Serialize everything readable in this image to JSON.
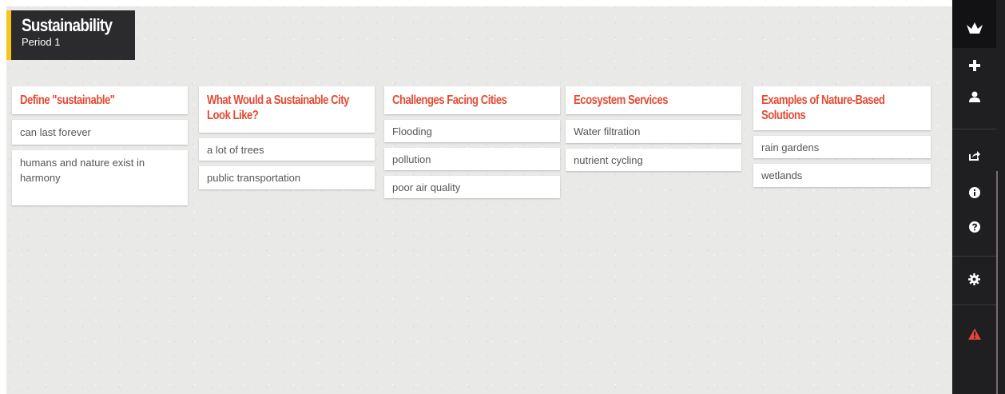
{
  "board": {
    "title": "Sustainability",
    "subtitle": "Period 1"
  },
  "columns": [
    {
      "title": "Define \"sustainable\"",
      "title_lines": [
        "Define \"sustainable\""
      ],
      "items": [
        "can last forever",
        "humans and nature exist in harmony"
      ]
    },
    {
      "title": "What Would a Sustainable City Look Like?",
      "title_lines": [
        "What Would a Sustainable City",
        "Look Like?"
      ],
      "items": [
        "a lot of trees",
        "public transportation"
      ]
    },
    {
      "title": "Challenges Facing Cities",
      "title_lines": [
        "Challenges Facing Cities"
      ],
      "items": [
        "Flooding",
        "pollution",
        "poor air quality"
      ]
    },
    {
      "title": "Ecosystem Services",
      "title_lines": [
        "Ecosystem Services"
      ],
      "items": [
        "Water filtration",
        "nutrient cycling"
      ]
    },
    {
      "title": "Examples of Nature-Based Solutions",
      "title_lines": [
        "Examples of Nature-Based",
        "Solutions"
      ],
      "items": [
        "rain gardens",
        "wetlands"
      ]
    }
  ],
  "sidebar": {
    "icons": [
      "logo-icon",
      "plus-icon",
      "user-icon",
      "share-icon",
      "info-icon",
      "help-icon",
      "gear-icon",
      "warning-icon"
    ]
  },
  "colors": {
    "accent": "#e54b35",
    "title_accent": "#f5c518",
    "sidebar_bg": "#1f1f21",
    "warning": "#e8443a"
  }
}
